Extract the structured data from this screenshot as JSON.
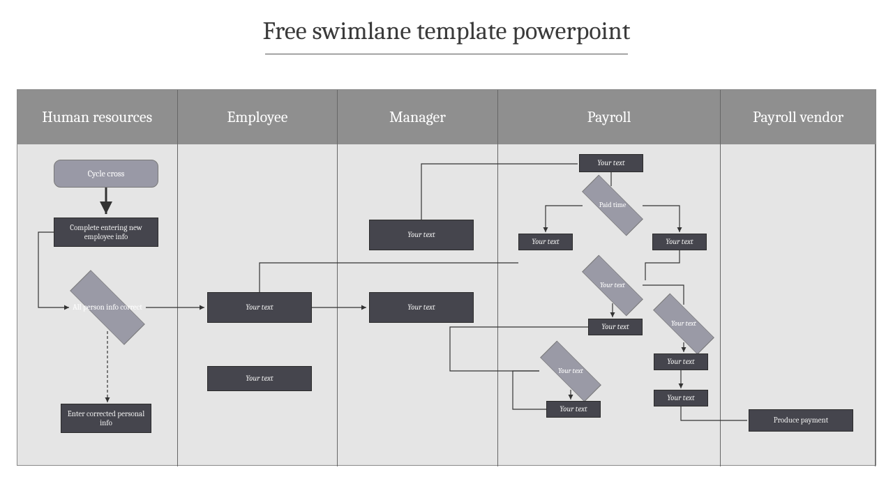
{
  "title": "Free swimlane template powerpoint",
  "lanes": {
    "hr": "Human resources",
    "emp": "Employee",
    "mgr": "Manager",
    "pay": "Payroll",
    "vend": "Payroll vendor"
  },
  "nodes": {
    "start": "Cycle cross",
    "hr_complete": "Complete entering new employee info",
    "hr_decision": "All person info correct",
    "hr_enter": "Enter corrected personal info",
    "emp_box1": "Your text",
    "emp_box2": "Your text",
    "mgr_box1": "Your text",
    "mgr_box2": "Your text",
    "pay_top": "Your text",
    "pay_dec1": "Paid time",
    "pay_left1": "Your text",
    "pay_right1": "Your text",
    "pay_dec2": "Your text",
    "pay_mid": "Your text",
    "pay_dec3": "Your text",
    "pay_dec4": "Your text",
    "pay_box3": "Your text",
    "pay_box4": "Your text",
    "pay_box5": "Your text",
    "vend_produce": "Produce payment"
  }
}
